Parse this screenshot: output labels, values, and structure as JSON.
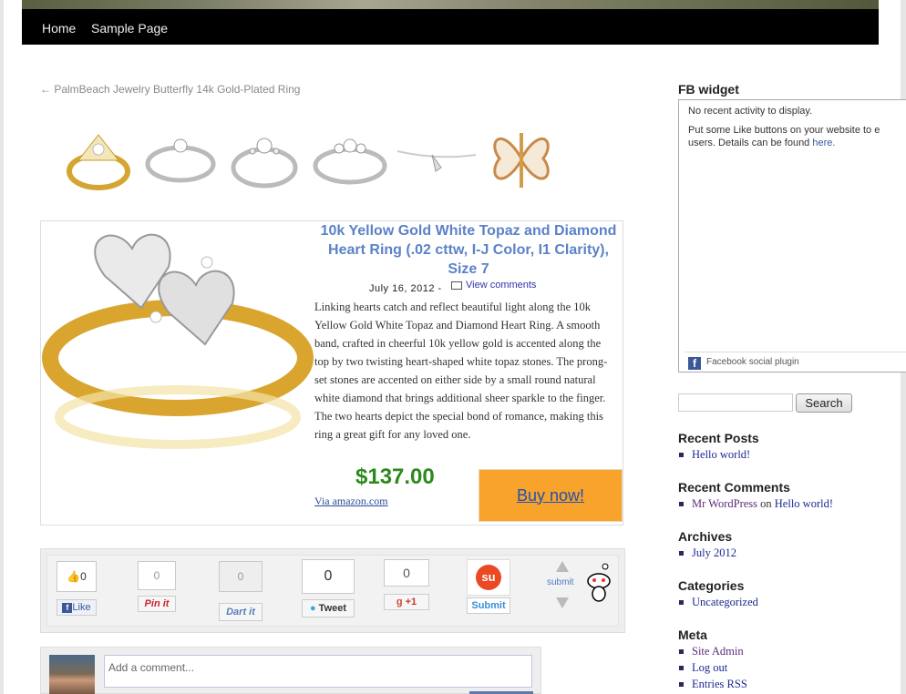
{
  "nav": {
    "items": [
      "Home",
      "Sample Page"
    ]
  },
  "prev_post": {
    "label": "← PalmBeach Jewelry Butterfly 14k Gold-Plated Ring"
  },
  "thumbnails": [
    {
      "icon": "gold-diamond-ring"
    },
    {
      "icon": "silver-solitaire-ring"
    },
    {
      "icon": "silver-diamond-ring"
    },
    {
      "icon": "silver-three-stone-ring"
    },
    {
      "icon": "silver-necklace"
    },
    {
      "icon": "butterfly-ring"
    }
  ],
  "product": {
    "title": "10k Yellow Gold White Topaz and Diamond Heart Ring (.02 cttw, I-J Color, I1 Clarity), Size 7",
    "date": "July 16, 2012 -",
    "comments_link": "View comments",
    "description": "Linking hearts catch and reflect beautiful light along the 10k Yellow Gold White Topaz and Diamond Heart Ring. A smooth band, crafted in cheerful 10k yellow gold is accented along the top by two twisting heart-shaped white topaz stones. The prong-set stones are accented on either side by a small round natural white diamond that brings additional sheer sparkle to the finger. The two hearts depict the special bond of romance, making this ring a great gift for any loved one.",
    "price": "$137.00",
    "via": "Via amazon.com",
    "buy_label": "Buy now!"
  },
  "share": {
    "facebook": {
      "count": "0",
      "label": "Like"
    },
    "pinterest": {
      "count": "0",
      "label": "Pin it"
    },
    "dartit": {
      "count": "0",
      "label": "Dart it"
    },
    "twitter": {
      "count": "0",
      "label": "Tweet"
    },
    "gplus": {
      "count": "0",
      "label": "+1"
    },
    "stumble": {
      "label": "Submit"
    },
    "reddit": {
      "label": "submit"
    }
  },
  "comment": {
    "placeholder": "Add a comment..."
  },
  "sidebar": {
    "fb_widget": {
      "title": "FB widget",
      "no_activity": "No recent activity to display.",
      "put_some": "Put some Like buttons on your website to e users. Details can be found ",
      "here": "here.",
      "plugin": "Facebook social plugin"
    },
    "search_label": "Search",
    "recent_posts": {
      "title": "Recent Posts",
      "items": [
        "Hello world!"
      ]
    },
    "recent_comments": {
      "title": "Recent Comments",
      "author": "Mr WordPress",
      "on": " on ",
      "post": "Hello world!"
    },
    "archives": {
      "title": "Archives",
      "items": [
        "July 2012"
      ]
    },
    "categories": {
      "title": "Categories",
      "items": [
        "Uncategorized"
      ]
    },
    "meta": {
      "title": "Meta",
      "items": [
        "Site Admin",
        "Log out",
        "Entries RSS"
      ]
    }
  }
}
